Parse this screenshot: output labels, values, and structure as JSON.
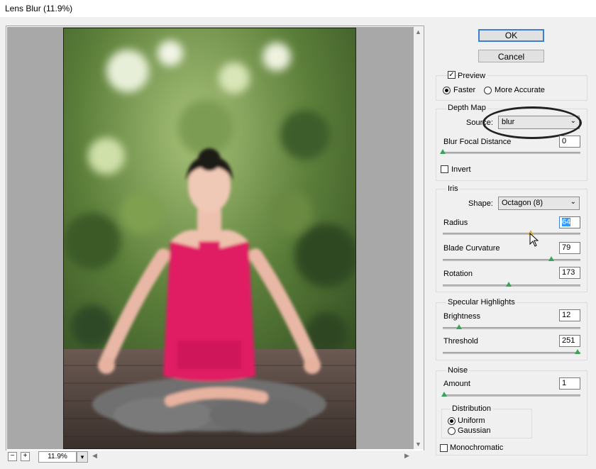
{
  "window": {
    "title": "Lens Blur (11.9%)"
  },
  "buttons": {
    "ok": "OK",
    "cancel": "Cancel"
  },
  "preview": {
    "preview_label": "Preview",
    "preview_checked": true,
    "faster_label": "Faster",
    "more_accurate_label": "More Accurate",
    "selected": "Faster"
  },
  "depth_map": {
    "group_label": "Depth Map",
    "source_label": "Source:",
    "source_value": "blur",
    "focal_label": "Blur Focal Distance",
    "focal_value": "0",
    "focal_level": 0.0,
    "invert_label": "Invert",
    "invert_checked": false
  },
  "iris": {
    "group_label": "Iris",
    "shape_label": "Shape:",
    "shape_value": "Octagon (8)",
    "radius_label": "Radius",
    "radius_value": "64",
    "radius_level": 0.64,
    "blade_label": "Blade Curvature",
    "blade_value": "79",
    "blade_level": 0.79,
    "rotation_label": "Rotation",
    "rotation_value": "173",
    "rotation_level": 0.48
  },
  "specular": {
    "group_label": "Specular Highlights",
    "brightness_label": "Brightness",
    "brightness_value": "12",
    "brightness_level": 0.12,
    "threshold_label": "Threshold",
    "threshold_value": "251",
    "threshold_level": 0.98
  },
  "noise": {
    "group_label": "Noise",
    "amount_label": "Amount",
    "amount_value": "1",
    "amount_level": 0.01,
    "distribution_label": "Distribution",
    "uniform_label": "Uniform",
    "gaussian_label": "Gaussian",
    "selected": "Uniform",
    "mono_label": "Monochromatic",
    "mono_checked": false
  },
  "status": {
    "zoom": "11.9%",
    "zoom_out": "−",
    "zoom_in": "+"
  }
}
